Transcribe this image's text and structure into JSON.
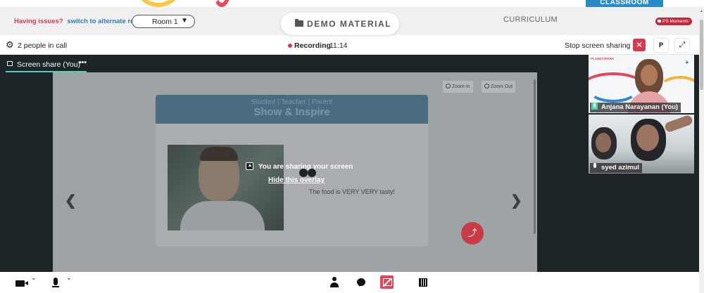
{
  "header": {
    "issue_text": "Having issues?",
    "alternate_link": "switch to alternate room",
    "room_select_value": "Room 1",
    "demo_material_label": "DEMO MATERIAL",
    "curriculum_label": "CURRICULUM",
    "classroom_badge": "CLASSROOM",
    "ps_moments_label": "PS Moments"
  },
  "callbar": {
    "people_count_text": "2 people in call",
    "recording_label": "Recording",
    "recording_time": "11:14",
    "stop_share_label": "Stop screen sharing",
    "stop_share_close": "✕",
    "p_button_label": "P",
    "expand_icon": "⤢"
  },
  "stage": {
    "tab_label": "Screen share (You)",
    "tab_menu": "•••",
    "zoom_in_label": "Zoom In",
    "zoom_out_label": "Zoom Out",
    "nav_prev": "❮",
    "nav_next": "❯",
    "slide": {
      "subtitle": "Student | Teacher | Parent",
      "title": "Show & Inspire",
      "caption": "The food is VERY VERY tasty!"
    },
    "overlay_message": "You are sharing your screen",
    "overlay_hide_link": "Hide this overlay",
    "share_fab_icon": "⤴"
  },
  "participants": [
    {
      "name": "Anjana Narayanan (You)",
      "mic": "on",
      "logo_text": "PLANETSPARK"
    },
    {
      "name": "syed azimul",
      "mic": "on"
    }
  ],
  "colors": {
    "accent_red": "#d9394e",
    "teal": "#4fd1b8",
    "stage_bg": "#1c2427",
    "link_blue": "#2f7cc0"
  }
}
